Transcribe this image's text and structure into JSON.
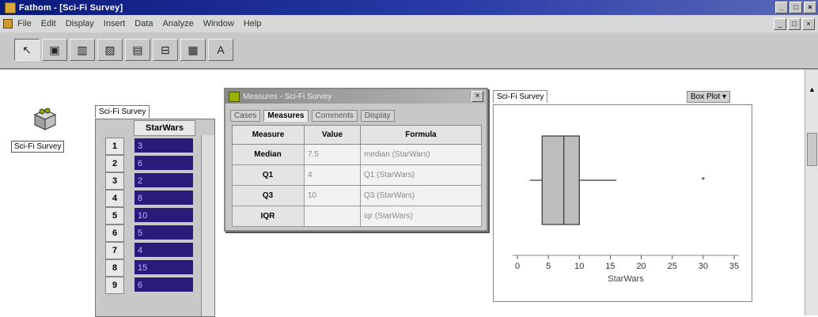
{
  "window": {
    "title": "Fathom - [Sci-Fi Survey]",
    "buttons": [
      "_",
      "□",
      "×"
    ]
  },
  "menu": {
    "items": [
      "File",
      "Edit",
      "Display",
      "Insert",
      "Data",
      "Analyze",
      "Window",
      "Help"
    ]
  },
  "toolbar": {
    "tools": [
      {
        "icon": "arrow-icon",
        "glyph": "↖"
      },
      {
        "icon": "collection-icon",
        "glyph": "▣"
      },
      {
        "icon": "case-table-icon",
        "glyph": "▥"
      },
      {
        "icon": "graph-icon",
        "glyph": "▨"
      },
      {
        "icon": "summary-table-icon",
        "glyph": "▤"
      },
      {
        "icon": "slider-icon",
        "glyph": "⊟"
      },
      {
        "icon": "estimate-icon",
        "glyph": "▦"
      },
      {
        "icon": "text-icon",
        "glyph": "A"
      }
    ]
  },
  "collection": {
    "label": "Sci-Fi Survey"
  },
  "case_table": {
    "tab": "Sci-Fi Survey",
    "column": "StarWars",
    "rows": [
      {
        "index": "1",
        "value": "3"
      },
      {
        "index": "2",
        "value": "6"
      },
      {
        "index": "3",
        "value": "2"
      },
      {
        "index": "4",
        "value": "8"
      },
      {
        "index": "5",
        "value": "10"
      },
      {
        "index": "6",
        "value": "5"
      },
      {
        "index": "7",
        "value": "4"
      },
      {
        "index": "8",
        "value": "15"
      },
      {
        "index": "9",
        "value": "6"
      }
    ]
  },
  "summary": {
    "title": "Measures - Sci-Fi Survey",
    "tabs": [
      "Cases",
      "Measures",
      "Comments",
      "Display"
    ],
    "active_tab": "Measures",
    "headers": [
      "Measure",
      "Value",
      "Formula"
    ],
    "rows": [
      {
        "measure": "Median",
        "value": "7.5",
        "formula": "median (StarWars)"
      },
      {
        "measure": "Q1",
        "value": "4",
        "formula": "Q1 (StarWars)"
      },
      {
        "measure": "Q3",
        "value": "10",
        "formula": "Q3 (StarWars)"
      },
      {
        "measure": "IQR",
        "value": "",
        "formula": "iqr (StarWars)"
      }
    ]
  },
  "graph": {
    "tab": "Sci-Fi Survey",
    "plot_type": "Box Plot ▾"
  },
  "chart_data": {
    "type": "box",
    "xlabel": "StarWars",
    "xlim": [
      0,
      35
    ],
    "ticks": [
      0,
      5,
      10,
      15,
      20,
      25,
      30,
      35
    ],
    "whisker_low": 2,
    "q1": 4,
    "median": 7.5,
    "q3": 10,
    "whisker_high": 16,
    "outliers": [
      30
    ]
  }
}
